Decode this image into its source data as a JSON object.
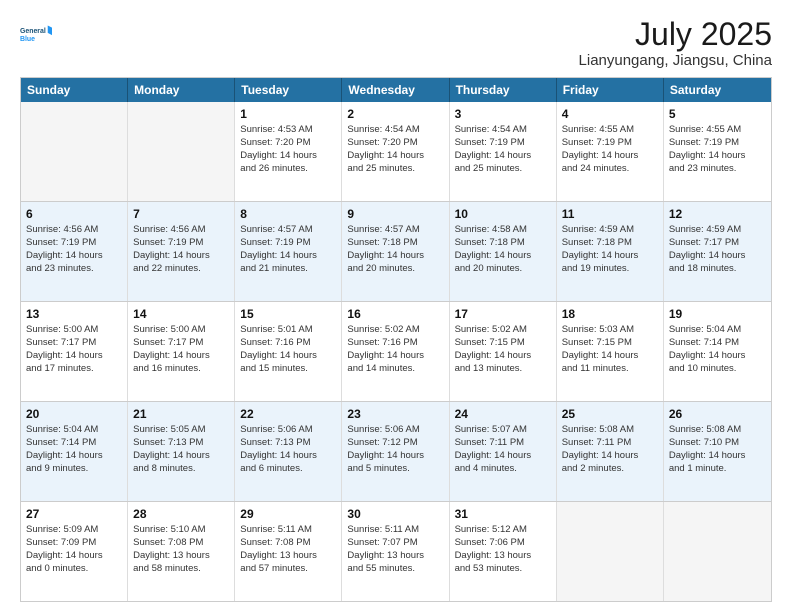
{
  "logo": {
    "general": "General",
    "blue": "Blue"
  },
  "title": "July 2025",
  "location": "Lianyungang, Jiangsu, China",
  "dayNames": [
    "Sunday",
    "Monday",
    "Tuesday",
    "Wednesday",
    "Thursday",
    "Friday",
    "Saturday"
  ],
  "weeks": [
    [
      {
        "day": "",
        "info": ""
      },
      {
        "day": "",
        "info": ""
      },
      {
        "day": "1",
        "info": "Sunrise: 4:53 AM\nSunset: 7:20 PM\nDaylight: 14 hours\nand 26 minutes."
      },
      {
        "day": "2",
        "info": "Sunrise: 4:54 AM\nSunset: 7:20 PM\nDaylight: 14 hours\nand 25 minutes."
      },
      {
        "day": "3",
        "info": "Sunrise: 4:54 AM\nSunset: 7:19 PM\nDaylight: 14 hours\nand 25 minutes."
      },
      {
        "day": "4",
        "info": "Sunrise: 4:55 AM\nSunset: 7:19 PM\nDaylight: 14 hours\nand 24 minutes."
      },
      {
        "day": "5",
        "info": "Sunrise: 4:55 AM\nSunset: 7:19 PM\nDaylight: 14 hours\nand 23 minutes."
      }
    ],
    [
      {
        "day": "6",
        "info": "Sunrise: 4:56 AM\nSunset: 7:19 PM\nDaylight: 14 hours\nand 23 minutes."
      },
      {
        "day": "7",
        "info": "Sunrise: 4:56 AM\nSunset: 7:19 PM\nDaylight: 14 hours\nand 22 minutes."
      },
      {
        "day": "8",
        "info": "Sunrise: 4:57 AM\nSunset: 7:19 PM\nDaylight: 14 hours\nand 21 minutes."
      },
      {
        "day": "9",
        "info": "Sunrise: 4:57 AM\nSunset: 7:18 PM\nDaylight: 14 hours\nand 20 minutes."
      },
      {
        "day": "10",
        "info": "Sunrise: 4:58 AM\nSunset: 7:18 PM\nDaylight: 14 hours\nand 20 minutes."
      },
      {
        "day": "11",
        "info": "Sunrise: 4:59 AM\nSunset: 7:18 PM\nDaylight: 14 hours\nand 19 minutes."
      },
      {
        "day": "12",
        "info": "Sunrise: 4:59 AM\nSunset: 7:17 PM\nDaylight: 14 hours\nand 18 minutes."
      }
    ],
    [
      {
        "day": "13",
        "info": "Sunrise: 5:00 AM\nSunset: 7:17 PM\nDaylight: 14 hours\nand 17 minutes."
      },
      {
        "day": "14",
        "info": "Sunrise: 5:00 AM\nSunset: 7:17 PM\nDaylight: 14 hours\nand 16 minutes."
      },
      {
        "day": "15",
        "info": "Sunrise: 5:01 AM\nSunset: 7:16 PM\nDaylight: 14 hours\nand 15 minutes."
      },
      {
        "day": "16",
        "info": "Sunrise: 5:02 AM\nSunset: 7:16 PM\nDaylight: 14 hours\nand 14 minutes."
      },
      {
        "day": "17",
        "info": "Sunrise: 5:02 AM\nSunset: 7:15 PM\nDaylight: 14 hours\nand 13 minutes."
      },
      {
        "day": "18",
        "info": "Sunrise: 5:03 AM\nSunset: 7:15 PM\nDaylight: 14 hours\nand 11 minutes."
      },
      {
        "day": "19",
        "info": "Sunrise: 5:04 AM\nSunset: 7:14 PM\nDaylight: 14 hours\nand 10 minutes."
      }
    ],
    [
      {
        "day": "20",
        "info": "Sunrise: 5:04 AM\nSunset: 7:14 PM\nDaylight: 14 hours\nand 9 minutes."
      },
      {
        "day": "21",
        "info": "Sunrise: 5:05 AM\nSunset: 7:13 PM\nDaylight: 14 hours\nand 8 minutes."
      },
      {
        "day": "22",
        "info": "Sunrise: 5:06 AM\nSunset: 7:13 PM\nDaylight: 14 hours\nand 6 minutes."
      },
      {
        "day": "23",
        "info": "Sunrise: 5:06 AM\nSunset: 7:12 PM\nDaylight: 14 hours\nand 5 minutes."
      },
      {
        "day": "24",
        "info": "Sunrise: 5:07 AM\nSunset: 7:11 PM\nDaylight: 14 hours\nand 4 minutes."
      },
      {
        "day": "25",
        "info": "Sunrise: 5:08 AM\nSunset: 7:11 PM\nDaylight: 14 hours\nand 2 minutes."
      },
      {
        "day": "26",
        "info": "Sunrise: 5:08 AM\nSunset: 7:10 PM\nDaylight: 14 hours\nand 1 minute."
      }
    ],
    [
      {
        "day": "27",
        "info": "Sunrise: 5:09 AM\nSunset: 7:09 PM\nDaylight: 14 hours\nand 0 minutes."
      },
      {
        "day": "28",
        "info": "Sunrise: 5:10 AM\nSunset: 7:08 PM\nDaylight: 13 hours\nand 58 minutes."
      },
      {
        "day": "29",
        "info": "Sunrise: 5:11 AM\nSunset: 7:08 PM\nDaylight: 13 hours\nand 57 minutes."
      },
      {
        "day": "30",
        "info": "Sunrise: 5:11 AM\nSunset: 7:07 PM\nDaylight: 13 hours\nand 55 minutes."
      },
      {
        "day": "31",
        "info": "Sunrise: 5:12 AM\nSunset: 7:06 PM\nDaylight: 13 hours\nand 53 minutes."
      },
      {
        "day": "",
        "info": ""
      },
      {
        "day": "",
        "info": ""
      }
    ]
  ]
}
